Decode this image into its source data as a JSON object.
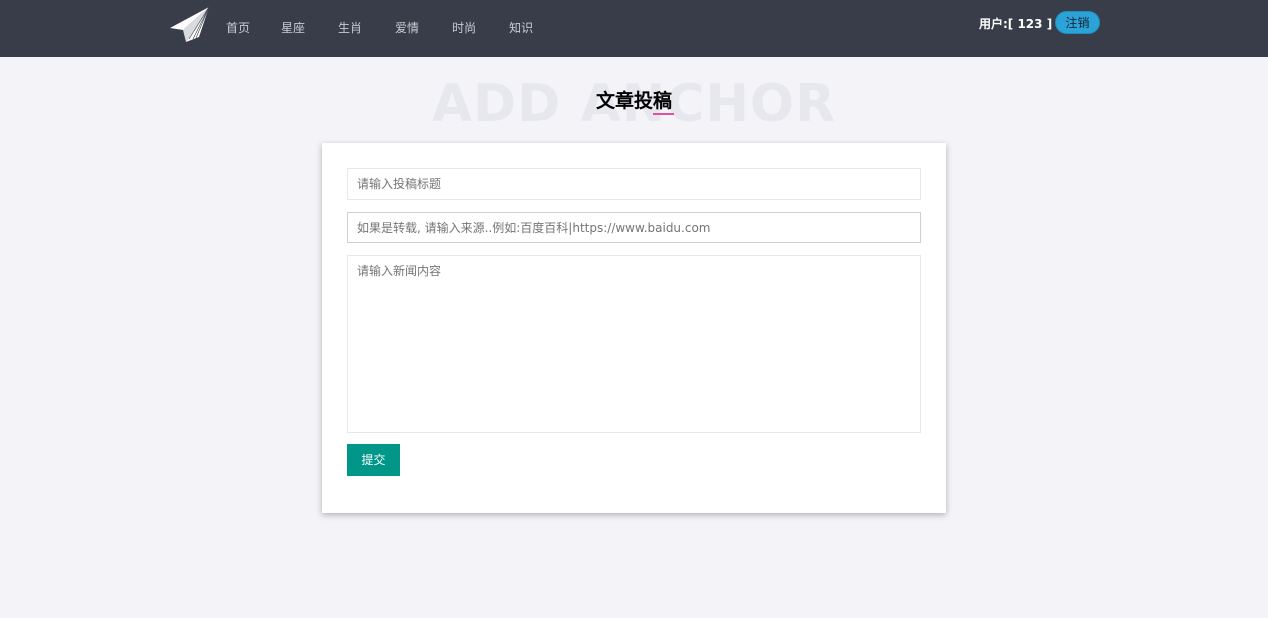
{
  "header": {
    "logo_icon": "paper-plane-icon",
    "nav": [
      {
        "label": "首页"
      },
      {
        "label": "星座"
      },
      {
        "label": "生肖"
      },
      {
        "label": "爱情"
      },
      {
        "label": "时尚"
      },
      {
        "label": "知识"
      }
    ],
    "user_label": "用户:[ 123 ]",
    "logout_label": "注销"
  },
  "page": {
    "watermark": "ADD ANCHOR",
    "title": "文章投稿"
  },
  "form": {
    "title_placeholder": "请输入投稿标题",
    "source_placeholder": "如果是转载, 请输入来源..例如:百度百科|https://www.baidu.com",
    "content_placeholder": "请输入新闻内容",
    "title_value": "",
    "source_value": "",
    "content_value": "",
    "submit_label": "提交"
  },
  "colors": {
    "topbar": "#393d49",
    "accent_submit": "#009688",
    "accent_logout": "#2ba3d6",
    "title_underline": "#e0529b"
  }
}
